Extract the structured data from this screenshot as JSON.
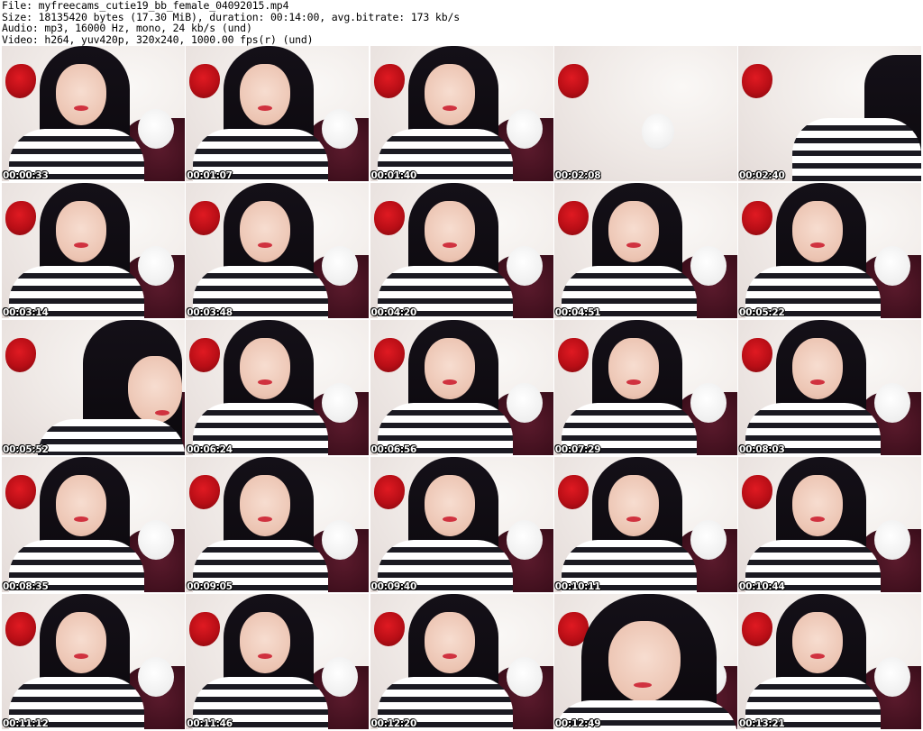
{
  "header": {
    "file_line": "File: myfreecams_cutie19_bb_female_04092015.mp4",
    "size_line": "Size: 18135420 bytes (17.30 MiB), duration: 00:14:00, avg.bitrate: 173 kb/s",
    "audio_line": "Audio: mp3, 16000 Hz, mono, 24 kb/s (und)",
    "video_line": "Video: h264, yuv420p, 320x240, 1000.00 fps(r) (und)"
  },
  "thumbnails": [
    {
      "timestamp": "00:00:33",
      "variant": "v-normal"
    },
    {
      "timestamp": "00:01:07",
      "variant": "v-normal"
    },
    {
      "timestamp": "00:01:40",
      "variant": "v-normal"
    },
    {
      "timestamp": "00:02:08",
      "variant": "v-empty"
    },
    {
      "timestamp": "00:02:40",
      "variant": "v-edge"
    },
    {
      "timestamp": "00:03:14",
      "variant": "v-normal"
    },
    {
      "timestamp": "00:03:48",
      "variant": "v-normal"
    },
    {
      "timestamp": "00:04:20",
      "variant": "v-normal"
    },
    {
      "timestamp": "00:04:51",
      "variant": "v-normal"
    },
    {
      "timestamp": "00:05:22",
      "variant": "v-normal"
    },
    {
      "timestamp": "00:05:52",
      "variant": "v-left"
    },
    {
      "timestamp": "00:06:24",
      "variant": "v-normal"
    },
    {
      "timestamp": "00:06:56",
      "variant": "v-normal"
    },
    {
      "timestamp": "00:07:29",
      "variant": "v-normal"
    },
    {
      "timestamp": "00:08:03",
      "variant": "v-normal"
    },
    {
      "timestamp": "00:08:35",
      "variant": "v-normal"
    },
    {
      "timestamp": "00:09:05",
      "variant": "v-normal"
    },
    {
      "timestamp": "00:09:40",
      "variant": "v-normal"
    },
    {
      "timestamp": "00:10:11",
      "variant": "v-normal"
    },
    {
      "timestamp": "00:10:44",
      "variant": "v-normal"
    },
    {
      "timestamp": "00:11:12",
      "variant": "v-normal"
    },
    {
      "timestamp": "00:11:46",
      "variant": "v-normal"
    },
    {
      "timestamp": "00:12:20",
      "variant": "v-normal"
    },
    {
      "timestamp": "00:12:49",
      "variant": "v-closeup"
    },
    {
      "timestamp": "00:13:21",
      "variant": "v-normal"
    }
  ]
}
